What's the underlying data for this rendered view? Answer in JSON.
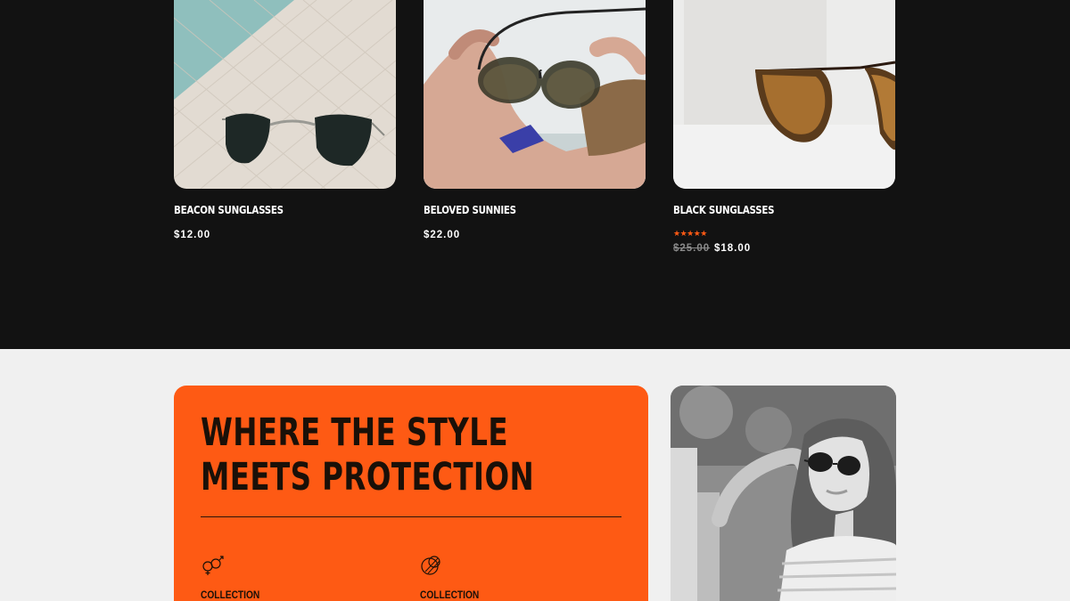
{
  "products": [
    {
      "name": "BEACON SUNGLASSES",
      "price": "$12.00",
      "image": "aviator-sunglasses-on-pool-tiles"
    },
    {
      "name": "BELOVED SUNNIES",
      "price": "$22.00",
      "image": "hand-holding-sunglasses"
    },
    {
      "name": "BLACK SUNGLASSES",
      "rating_stars": "★★★★★",
      "rating": 5,
      "price_old": "$25.00",
      "price_new": "$18.00",
      "image": "tortoise-cat-eye-sunglasses"
    }
  ],
  "promo": {
    "title_line1": "WHERE THE STYLE",
    "title_line2": "MEETS PROTECTION",
    "features": [
      {
        "icon": "gender-symbols-icon",
        "label": "COLLECTION"
      },
      {
        "icon": "lens-circles-icon",
        "label": "COLLECTION"
      }
    ],
    "photo": "woman-wearing-sunglasses-grayscale"
  },
  "colors": {
    "dark_bg": "#121212",
    "light_bg": "#f0f0f0",
    "accent_orange": "#fe5a14",
    "star_color": "#ff5a14",
    "strike_gray": "#8a8a8a"
  }
}
